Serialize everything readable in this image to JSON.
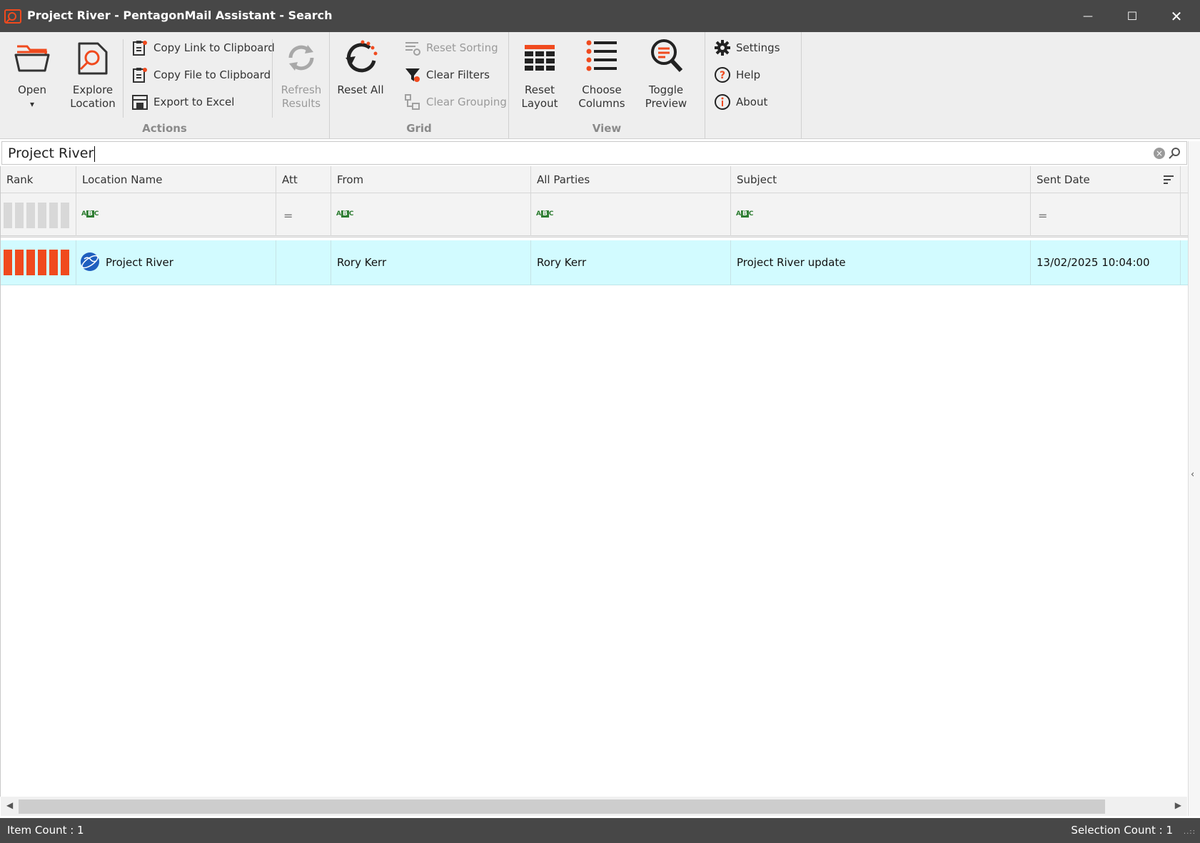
{
  "window": {
    "title": "Project River - PentagonMail Assistant - Search",
    "minimize": "—",
    "maximize": "☐",
    "close": "✕"
  },
  "ribbon": {
    "actions": {
      "label": "Actions",
      "open": "Open",
      "open_caret": "▾",
      "explore_line1": "Explore",
      "explore_line2": "Location",
      "copy_link": "Copy Link to Clipboard",
      "copy_file": "Copy File to Clipboard",
      "export_excel": "Export to Excel",
      "refresh_line1": "Refresh",
      "refresh_line2": "Results"
    },
    "grid": {
      "label": "Grid",
      "reset_all": "Reset All",
      "reset_sorting": "Reset Sorting",
      "clear_filters": "Clear Filters",
      "clear_grouping": "Clear Grouping"
    },
    "view": {
      "label": "View",
      "reset_layout_line1": "Reset",
      "reset_layout_line2": "Layout",
      "choose_columns_line1": "Choose",
      "choose_columns_line2": "Columns",
      "toggle_preview_line1": "Toggle",
      "toggle_preview_line2": "Preview"
    },
    "misc": {
      "settings": "Settings",
      "help": "Help",
      "about": "About"
    }
  },
  "search": {
    "value": "Project River",
    "clear_glyph": "×"
  },
  "columns": [
    "Rank",
    "Location Name",
    "Att",
    "From",
    "All Parties",
    "Subject",
    "Sent Date"
  ],
  "filter_glyphs": {
    "abc_a": "A",
    "abc_b": "B",
    "abc_c": "C",
    "equals": "="
  },
  "rows": [
    {
      "rank": 6,
      "location_name": "Project River",
      "att": "",
      "from": "Rory Kerr",
      "all_parties": "Rory Kerr",
      "subject": "Project River update",
      "sent_date": "13/02/2025 10:04:00"
    }
  ],
  "status": {
    "item_count": "Item Count : 1",
    "selection_count": "Selection Count : 1",
    "grip": "..::"
  },
  "scroll": {
    "left_arrow": "◀",
    "right_arrow": "▶",
    "collapse_chevron": "‹"
  },
  "colors": {
    "accent": "#f04a1e",
    "selected_row": "#d2fbff",
    "chrome": "#474747"
  }
}
